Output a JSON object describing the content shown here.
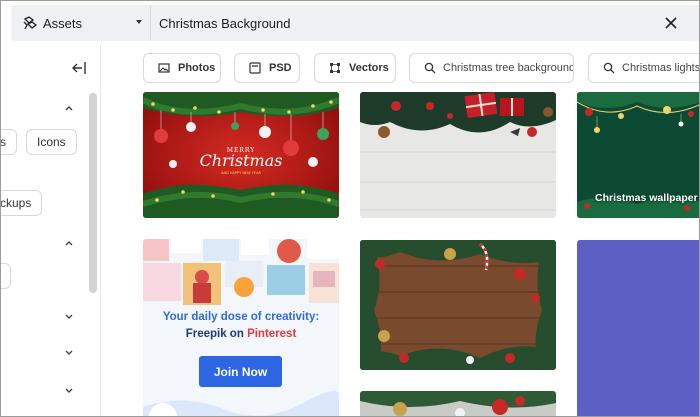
{
  "topbar": {
    "asset_type": "Assets",
    "search_value": "Christmas Background",
    "icons": {
      "assets": "asset-type-icon",
      "clear": "close-icon",
      "dropdown": "caret-down-icon"
    }
  },
  "sidebar": {
    "pills": [
      "s",
      "Icons",
      "ckups",
      ""
    ],
    "icons": {
      "collapse": "collapse-sidebar-icon"
    }
  },
  "filters": [
    {
      "label": "Photos",
      "icon": "photo-icon"
    },
    {
      "label": "PSD",
      "icon": "psd-icon"
    },
    {
      "label": "Vectors",
      "icon": "vectors-icon"
    },
    {
      "label": "Christmas tree background",
      "icon": "search-icon"
    },
    {
      "label": "Christmas lights backgrounds",
      "icon": "search-icon"
    }
  ],
  "results": {
    "card1_title": "MERRY",
    "card1_word": "Christmas",
    "card1_sub": "AND HAPPY NEW YEAR",
    "card3_caption": "Christmas wallpaper"
  },
  "ad": {
    "line1": "Your daily dose of creativity:",
    "line2_prefix": "Freepik on ",
    "line2_brand": "Pinterest",
    "button": "Join Now"
  },
  "colors": {
    "accent": "#2d66e3",
    "pinterest": "#e03a3a",
    "topbar_bg": "#eef0f3"
  }
}
